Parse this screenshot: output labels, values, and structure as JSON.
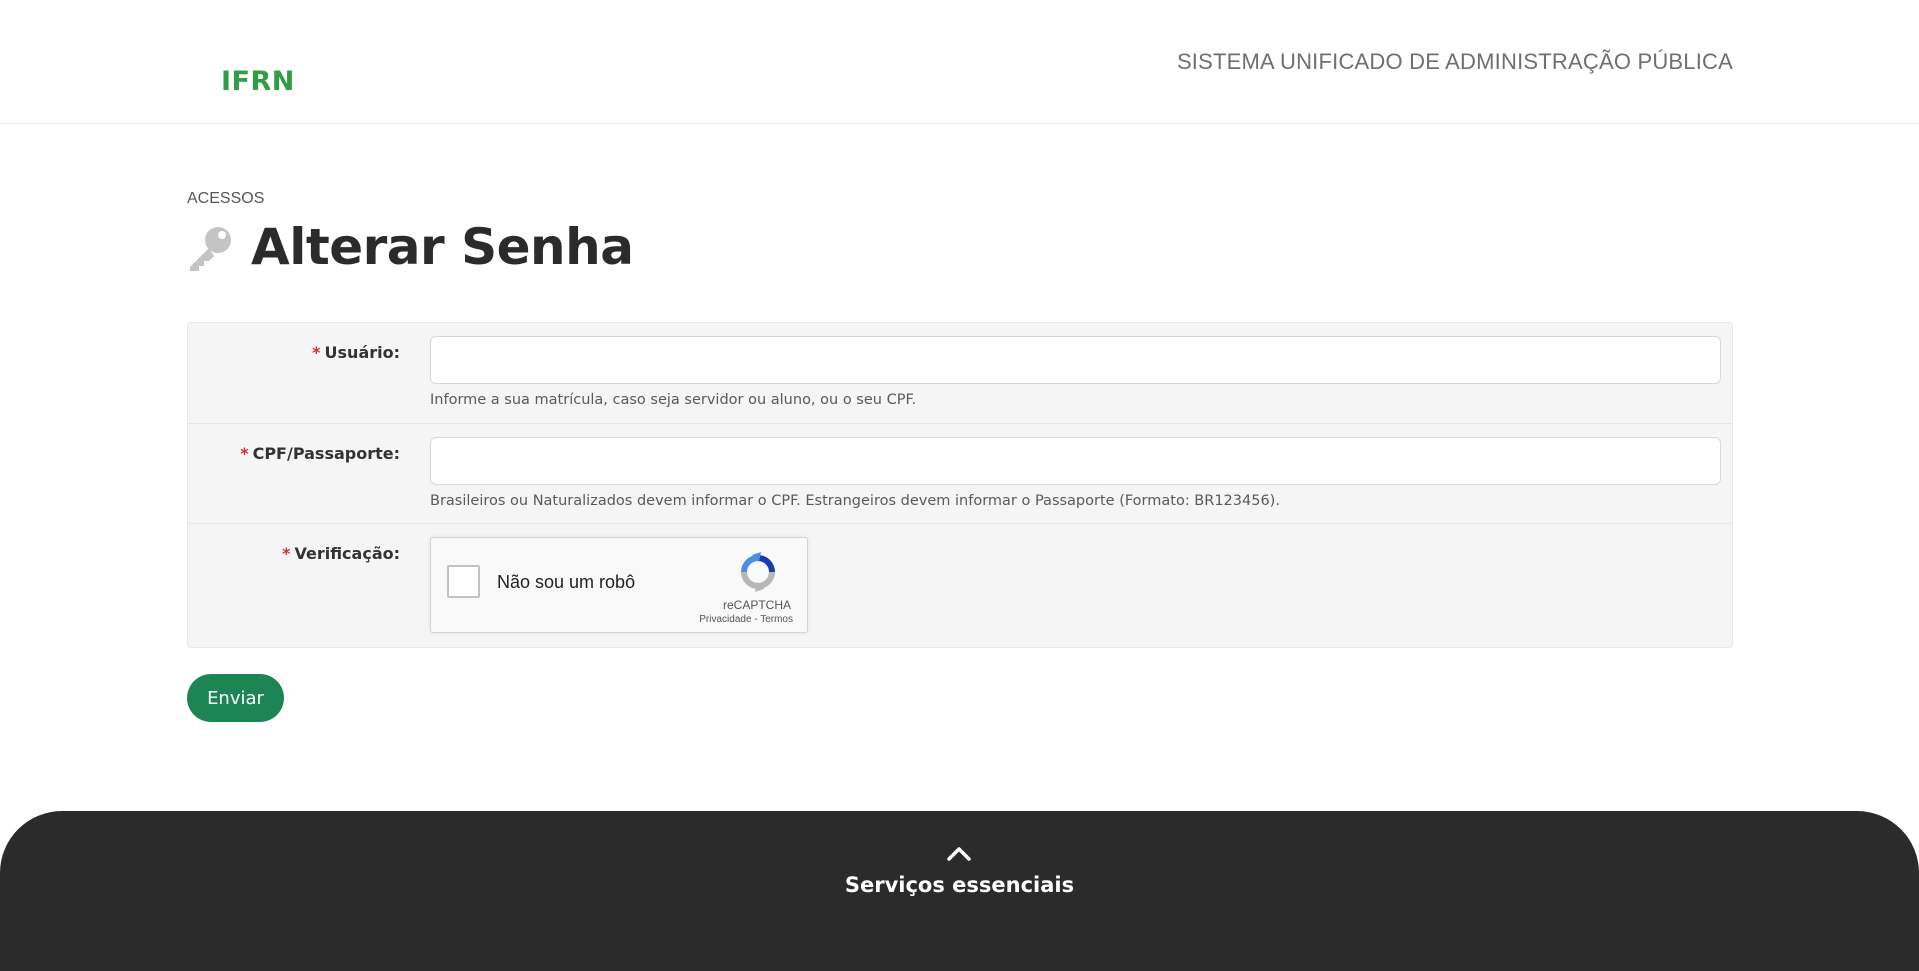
{
  "header": {
    "logo": "IFRN",
    "system_title": "SISTEMA UNIFICADO DE ADMINISTRAÇÃO PÚBLICA",
    "logo_color": "#2f9e44"
  },
  "breadcrumb": "ACESSOS",
  "page": {
    "title": "Alterar Senha",
    "icon": "key-icon"
  },
  "form": {
    "required_mark": "*",
    "fields": [
      {
        "label": "Usuário:",
        "value": "",
        "help": "Informe a sua matrícula, caso seja servidor ou aluno, ou o seu CPF."
      },
      {
        "label": "CPF/Passaporte:",
        "value": "",
        "help": "Brasileiros ou Naturalizados devem informar o CPF. Estrangeiros devem informar o Passaporte (Formato: BR123456)."
      },
      {
        "label": "Verificação:"
      }
    ],
    "recaptcha": {
      "label": "Não sou um robô",
      "brand": "reCAPTCHA",
      "links": "Privacidade - Termos",
      "checked": false
    },
    "submit_label": "Enviar",
    "submit_color": "#1d8553"
  },
  "footer": {
    "title": "Serviços essenciais",
    "icon": "chevron-up-icon",
    "background": "#2b2b2b"
  }
}
